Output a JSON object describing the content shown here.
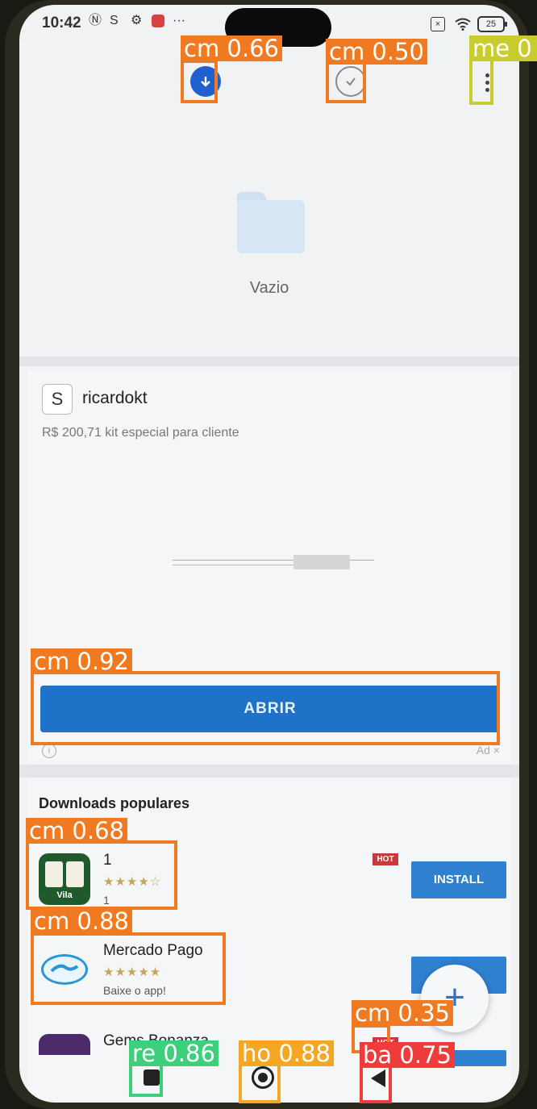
{
  "status": {
    "time": "10:42",
    "battery": "25",
    "more": "···"
  },
  "empty": {
    "label": "Vazio"
  },
  "ad": {
    "avatar_letter": "S",
    "name": "ricardokt",
    "subtitle": "R$ 200,71 kit especial para cliente",
    "button": "ABRIR",
    "tag": "Ad ×",
    "info": "i"
  },
  "popular": {
    "title": "Downloads populares",
    "apps": [
      {
        "name": "1",
        "stars": "★★★★☆",
        "sub": "1",
        "hot": "HOT",
        "action": "INSTALL",
        "icon": "mahjong-app-icon",
        "icon_text": "Vila"
      },
      {
        "name": "Mercado Pago",
        "stars": "★★★★★",
        "sub": "Baixe o app!",
        "icon": "handshake-app-icon"
      },
      {
        "name": "Gems Bonanza",
        "hot": "HOT",
        "icon": "gems-app-icon"
      }
    ],
    "fab": "+"
  },
  "detections": [
    {
      "label": "cm 0.66",
      "color": "#f07a22"
    },
    {
      "label": "cm 0.50",
      "color": "#f07a22"
    },
    {
      "label": "me 0",
      "color": "#c8cc2e"
    },
    {
      "label": "cm 0.92",
      "color": "#f07a22"
    },
    {
      "label": "cm 0.68",
      "color": "#f07a22"
    },
    {
      "label": "cm 0.88",
      "color": "#f07a22"
    },
    {
      "label": "cm 0.35",
      "color": "#f07a22"
    },
    {
      "label": "re 0.86",
      "color": "#3ecf7c"
    },
    {
      "label": "ho 0.88",
      "color": "#f5a623"
    },
    {
      "label": "ba 0.75",
      "color": "#ee3b3b"
    }
  ]
}
